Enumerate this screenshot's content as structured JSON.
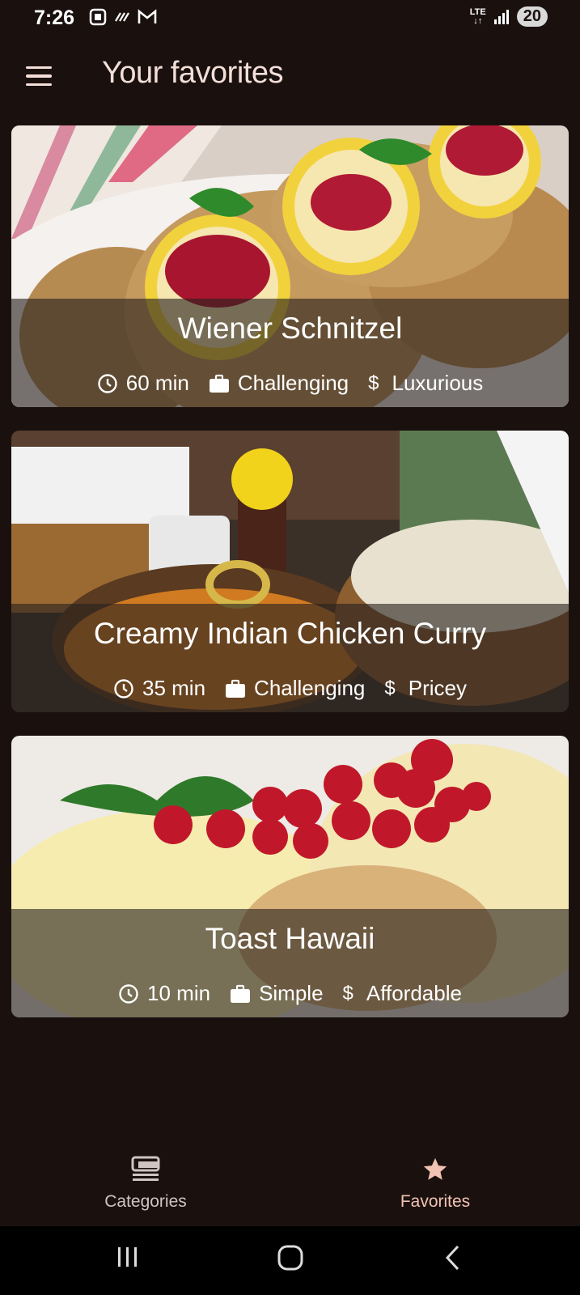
{
  "status_bar": {
    "time": "7:26",
    "network": "LTE",
    "battery": "20"
  },
  "app_bar": {
    "title": "Your favorites"
  },
  "meals": [
    {
      "title": "Wiener Schnitzel",
      "duration": "60 min",
      "complexity": "Challenging",
      "affordability": "Luxurious"
    },
    {
      "title": "Creamy Indian Chicken Curry",
      "duration": "35 min",
      "complexity": "Challenging",
      "affordability": "Pricey"
    },
    {
      "title": "Toast Hawaii",
      "duration": "10 min",
      "complexity": "Simple",
      "affordability": "Affordable"
    }
  ],
  "bottom_nav": {
    "categories_label": "Categories",
    "favorites_label": "Favorites"
  },
  "colors": {
    "background": "#1a110f",
    "accent": "#f2c2b2",
    "title": "#f3dfd8"
  },
  "icons": {
    "time": "clock-icon",
    "complexity": "briefcase-icon",
    "affordability": "dollar-icon"
  }
}
